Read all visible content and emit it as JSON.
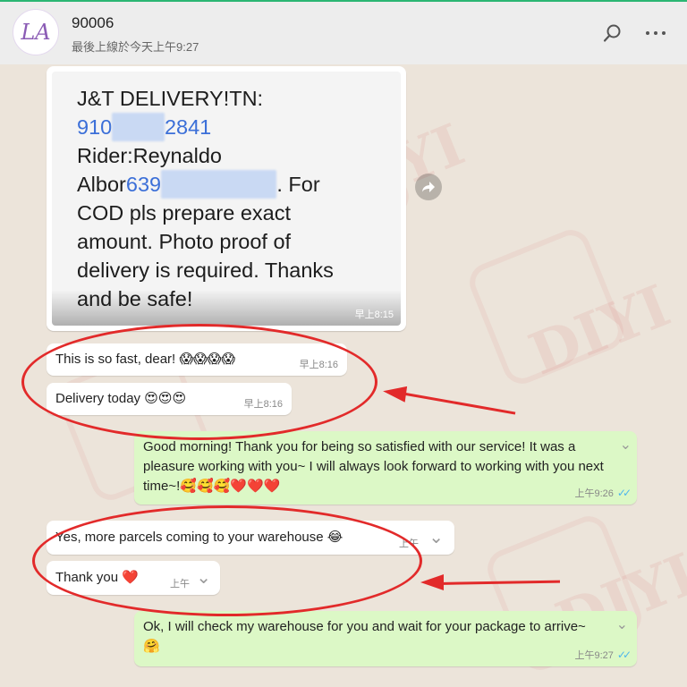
{
  "header": {
    "avatar_text": "LA",
    "contact_name": "90006",
    "last_seen": "最後上線於今天上午9:27",
    "search_icon": "search-icon",
    "menu_icon": "more-options-icon"
  },
  "watermark": {
    "brand": "DIYI"
  },
  "image_message": {
    "line1": "J&T DELIVERY!TN:",
    "tracking_start": "910",
    "tracking_end": "2841",
    "line3": "Rider:Reynaldo",
    "rider_name_part": "Albor",
    "phone_start": "639",
    "line4_rest": ". For",
    "line5": "COD pls prepare exact",
    "line6": "amount. Photo proof of",
    "line7": "delivery is required. Thanks",
    "line8": "and be safe!",
    "time": "早上8:15"
  },
  "messages": {
    "m1_text": "This is so fast, dear! 😱😱😱😱",
    "m1_time": "早上8:16",
    "m2_text": "Delivery today 😍😍😍",
    "m2_time": "早上8:16",
    "m3_text": "Good morning! Thank you for being so satisfied with our service! It was a pleasure working with you~ I will always look forward to working with you next time~!🥰🥰🥰❤️❤️❤️",
    "m3_time": "上午9:26",
    "m4_text": "Yes, more parcels coming to your warehouse 😂",
    "m4_time": "上午",
    "m5_text": "Thank you ❤️",
    "m5_time": "上午",
    "m6_text": "Ok, I will check my warehouse for you and wait for your package to arrive~🤗",
    "m6_time": "上午9:27"
  },
  "colors": {
    "incoming_bubble": "#ffffff",
    "outgoing_bubble": "#dcf8c6",
    "annotation_red": "#e22a2a",
    "read_ticks": "#4fb6ec"
  }
}
